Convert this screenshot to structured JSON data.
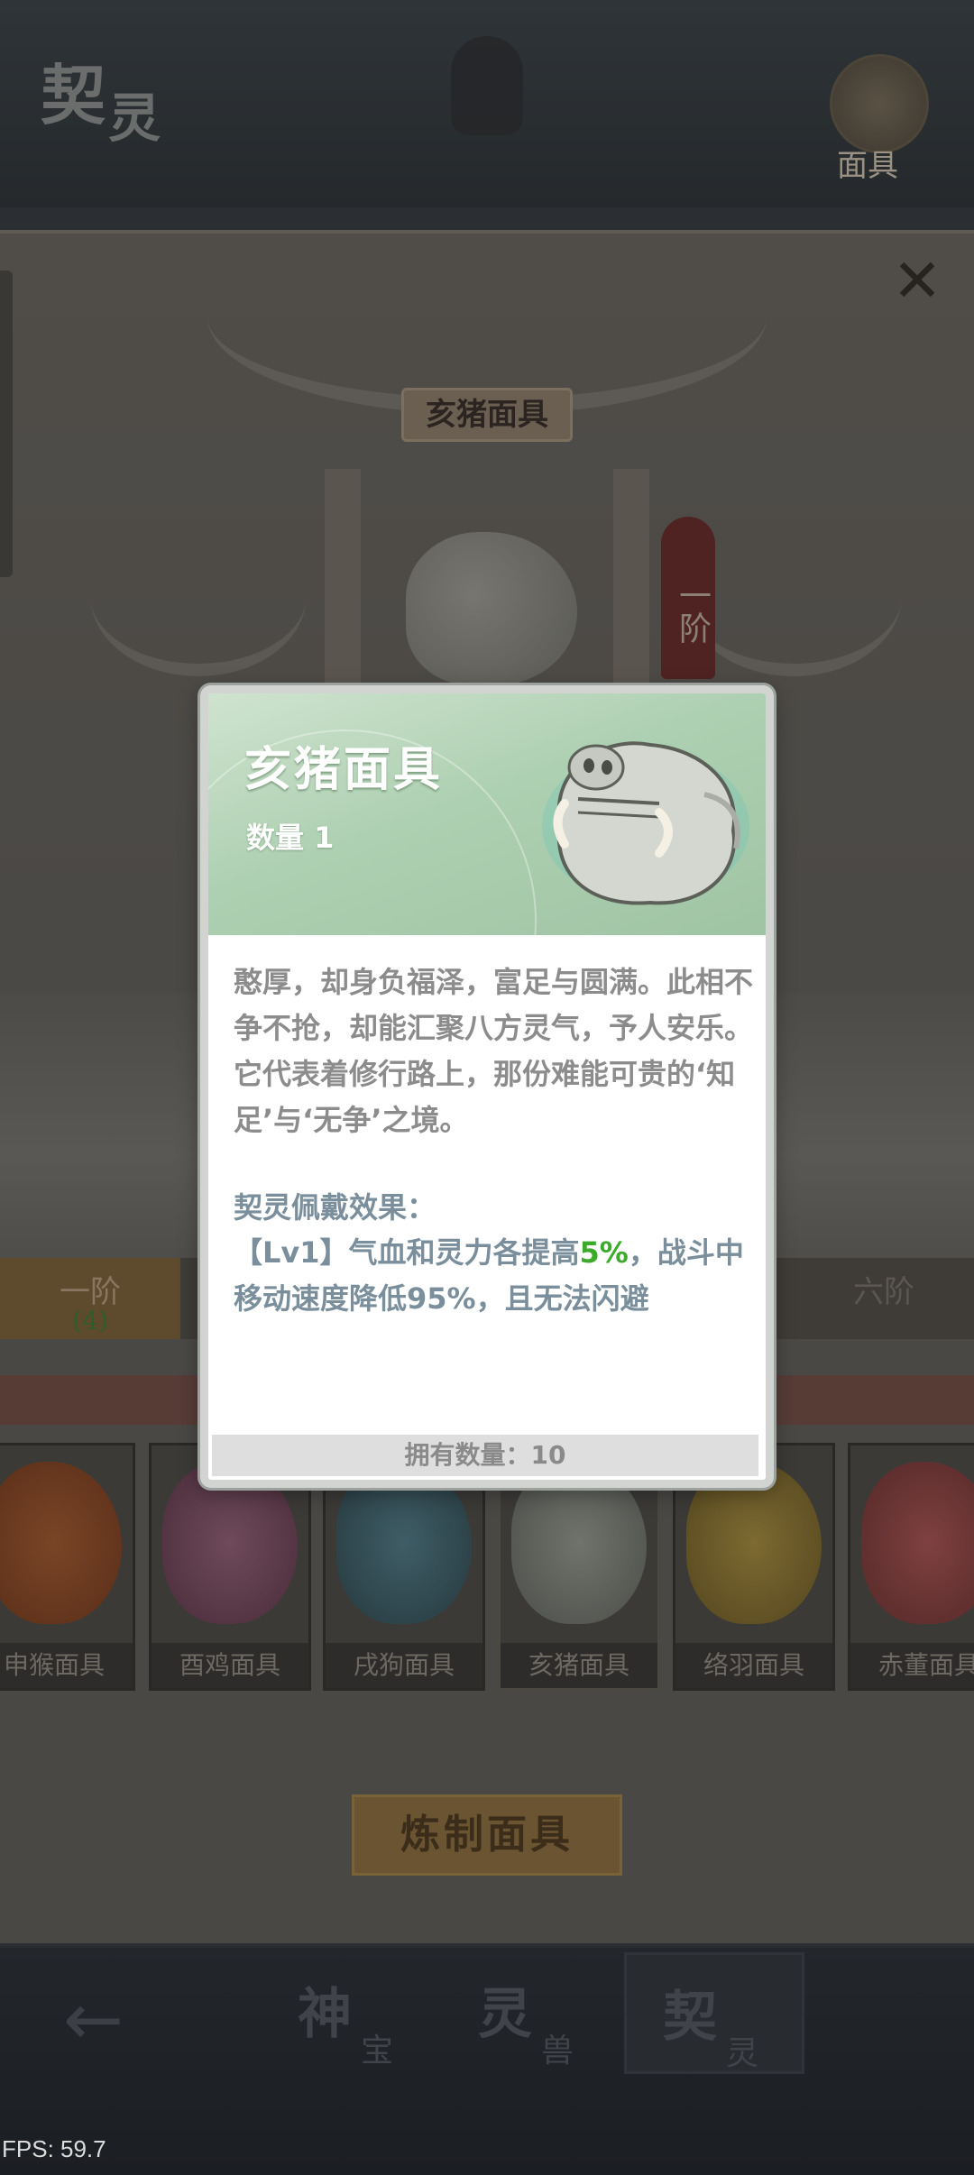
{
  "header": {
    "logo_text_1": "契",
    "logo_text_2": "灵",
    "mask_button_label": "面具"
  },
  "panel": {
    "gate_title": "亥猪面具",
    "rank_banner": "一阶",
    "close_icon": "✕"
  },
  "rank_tabs": [
    {
      "label": "一阶",
      "count": "(4)"
    },
    {
      "label": "六阶"
    }
  ],
  "cards": [
    {
      "name": "申猴面具",
      "color": "#6b3a22"
    },
    {
      "name": "酉鸡面具",
      "color": "#5a3a4a"
    },
    {
      "name": "戌狗面具",
      "color": "#2f4a52"
    },
    {
      "name": "亥猪面具",
      "color": "#5b5e58"
    },
    {
      "name": "络羽面具",
      "color": "#6a5a2c"
    },
    {
      "name": "赤董面具",
      "color": "#6b3433"
    }
  ],
  "craft_button": "炼制面具",
  "bottom_nav": {
    "back_icon": "←",
    "tabs": [
      {
        "big": "神",
        "small": "宝"
      },
      {
        "big": "灵",
        "small": "兽"
      },
      {
        "big": "契",
        "small": "灵"
      }
    ]
  },
  "fps": "FPS: 59.7",
  "popup": {
    "title": "亥猪面具",
    "quantity": "数量 1",
    "description": "憨厚，却身负福泽，富足与圆满。此相不争不抢，却能汇聚八方灵气，予人安乐。它代表着修行路上，那份难能可贵的‘知足’与‘无争’之境。",
    "effect_label": "契灵佩戴效果：",
    "effect_prefix": "【Lv1】气血和灵力各提高",
    "effect_highlight": "5%",
    "effect_suffix": "，战斗中移动速度降低95%，且无法闪避",
    "own_count": "拥有数量：10"
  }
}
